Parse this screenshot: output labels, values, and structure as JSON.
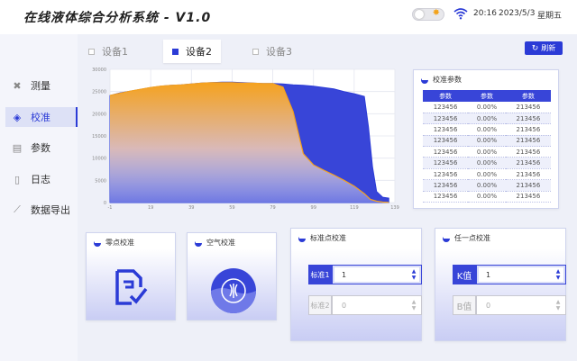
{
  "header": {
    "title": "在线液体综合分析系统  - V1.0",
    "time": "20:16",
    "date": "2023/5/3",
    "weekday": "星期五"
  },
  "sidebar": {
    "items": [
      {
        "label": "测量",
        "icon": "tools-icon",
        "active": false
      },
      {
        "label": "校准",
        "icon": "target-icon",
        "active": true
      },
      {
        "label": "参数",
        "icon": "monitor-icon",
        "active": false
      },
      {
        "label": "日志",
        "icon": "document-icon",
        "active": false
      },
      {
        "label": "数据导出",
        "icon": "line-chart-icon",
        "active": false
      }
    ]
  },
  "tabs": [
    {
      "label": "设备1",
      "active": false
    },
    {
      "label": "设备2",
      "active": true
    },
    {
      "label": "设备3",
      "active": false
    }
  ],
  "refresh_label": "刷新",
  "colors": {
    "accent": "#2b3bd6",
    "orange": "#f5a21f",
    "blue_series": "#2b3bd6"
  },
  "chart_data": {
    "type": "area",
    "x_ticks": [
      "-1",
      "19",
      "39",
      "59",
      "79",
      "99",
      "119",
      "139"
    ],
    "y_ticks": [
      "0",
      "5000",
      "10000",
      "15000",
      "20000",
      "25000",
      "30000"
    ],
    "ylim": [
      0,
      30000
    ],
    "xlim": [
      -1,
      139
    ],
    "grid": true,
    "series": [
      {
        "color": "#2b3bd6",
        "x": [
          -1,
          4,
          9,
          14,
          19,
          24,
          29,
          34,
          39,
          44,
          49,
          54,
          59,
          64,
          69,
          74,
          79,
          84,
          89,
          94,
          99,
          104,
          109,
          114,
          119,
          124,
          126,
          128,
          130,
          133,
          136
        ],
        "y": [
          24100,
          24700,
          25100,
          25500,
          25900,
          26200,
          26400,
          26500,
          26700,
          26900,
          27000,
          27100,
          27100,
          27000,
          26900,
          26800,
          26800,
          26700,
          26500,
          26400,
          26200,
          25900,
          25600,
          25000,
          24500,
          23900,
          17000,
          8000,
          2500,
          1200,
          1000
        ]
      },
      {
        "color": "#f5a21f",
        "x": [
          -1,
          4,
          9,
          14,
          19,
          24,
          29,
          34,
          39,
          44,
          49,
          54,
          59,
          64,
          69,
          74,
          79,
          84,
          89,
          94,
          99,
          104,
          109,
          114,
          119,
          124,
          127,
          130,
          133,
          136
        ],
        "y": [
          24100,
          24600,
          25100,
          25500,
          25900,
          26200,
          26400,
          26500,
          26700,
          26900,
          27000,
          27000,
          27000,
          26900,
          26900,
          26800,
          26800,
          26000,
          20500,
          11000,
          8500,
          7300,
          6200,
          5000,
          3700,
          2000,
          700,
          300,
          100,
          50
        ]
      }
    ]
  },
  "calib_table": {
    "title": "校准参数",
    "headers": [
      "参数",
      "参数",
      "参数"
    ],
    "rows": [
      [
        "123456",
        "0.00%",
        "213456"
      ],
      [
        "123456",
        "0.00%",
        "213456"
      ],
      [
        "123456",
        "0.00%",
        "213456"
      ],
      [
        "123456",
        "0.00%",
        "213456"
      ],
      [
        "123456",
        "0.00%",
        "213456"
      ],
      [
        "123456",
        "0.00%",
        "213456"
      ],
      [
        "123456",
        "0.00%",
        "213456"
      ],
      [
        "123456",
        "0.00%",
        "213456"
      ],
      [
        "123456",
        "0.00%",
        "213456"
      ]
    ]
  },
  "cards": {
    "zero": {
      "title": "零点校准",
      "icon": "document-check-icon"
    },
    "air": {
      "title": "空气校准",
      "icon": "air-gauge-icon"
    },
    "std": {
      "title": "标准点校准",
      "fields": [
        {
          "label": "标准1",
          "value": "1",
          "active": true
        },
        {
          "label": "标准2",
          "value": "0",
          "active": false
        }
      ]
    },
    "any": {
      "title": "任一点校准",
      "fields": [
        {
          "label": "K值",
          "value": "1",
          "active": true
        },
        {
          "label": "B值",
          "value": "0",
          "active": false
        }
      ]
    }
  }
}
